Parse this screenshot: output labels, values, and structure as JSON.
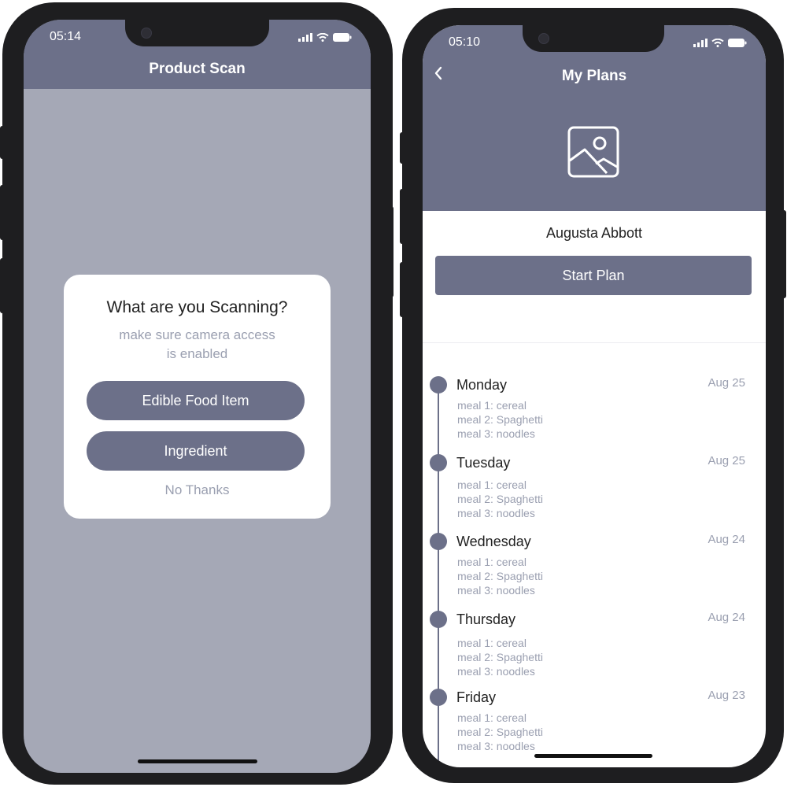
{
  "left_phone": {
    "status": {
      "time": "05:14"
    },
    "header": {
      "title": "Product Scan"
    },
    "dialog": {
      "title": "What are you Scanning?",
      "subtitle_line1": "make sure camera access",
      "subtitle_line2": "is enabled",
      "option1": "Edible Food Item",
      "option2": "Ingredient",
      "dismiss": "No Thanks"
    }
  },
  "right_phone": {
    "status": {
      "time": "05:10"
    },
    "header": {
      "title": "My Plans",
      "back_icon": "chevron-left",
      "image_icon": "image-placeholder"
    },
    "profile": {
      "name": "Augusta Abbott"
    },
    "start_button": "Start Plan",
    "days": [
      {
        "name": "Monday",
        "date": "Aug 25",
        "meal1": "meal 1:  cereal",
        "meal2": "meal 2: Spaghetti",
        "meal3": "meal 3: noodles"
      },
      {
        "name": "Tuesday",
        "date": "Aug 25",
        "meal1": "meal 1:  cereal",
        "meal2": "meal 2: Spaghetti",
        "meal3": "meal 3: noodles"
      },
      {
        "name": "Wednesday",
        "date": "Aug 24",
        "meal1": "meal 1:  cereal",
        "meal2": "meal 2: Spaghetti",
        "meal3": "meal 3: noodles"
      },
      {
        "name": "Thursday",
        "date": "Aug 24",
        "meal1": "meal 1:  cereal",
        "meal2": "meal 2: Spaghetti",
        "meal3": "meal 3: noodles"
      },
      {
        "name": "Friday",
        "date": "Aug 23",
        "meal1": "meal 1:  cereal",
        "meal2": "meal 2: Spaghetti",
        "meal3": "meal 3: noodles"
      }
    ]
  },
  "colors": {
    "accent": "#6c7089",
    "overlay": "#a5a8b6",
    "muted_text": "#9a9fb0"
  }
}
